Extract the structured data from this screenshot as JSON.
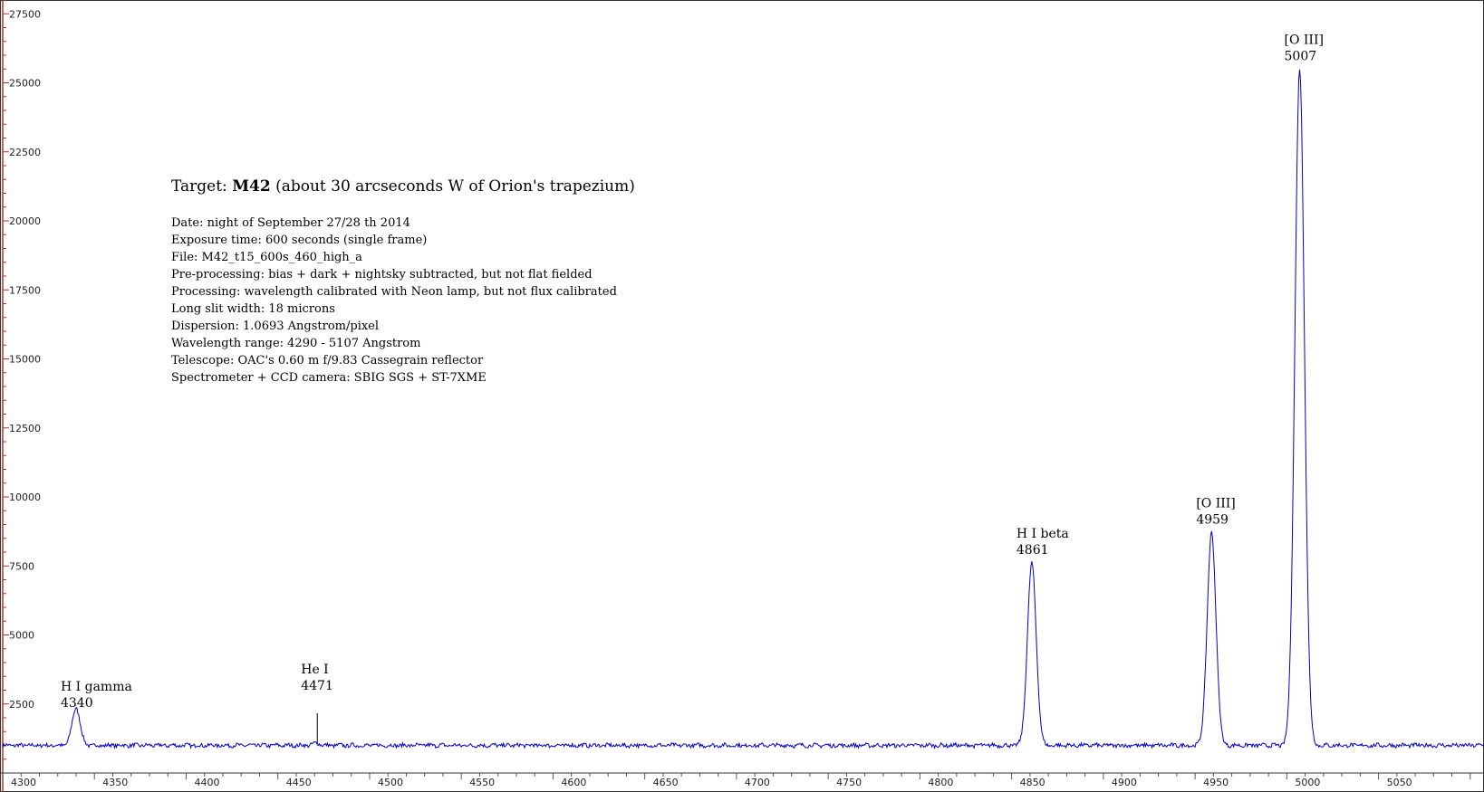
{
  "chart_data": {
    "type": "line",
    "xlim": [
      4300,
      5107
    ],
    "ylim": [
      0,
      28000
    ],
    "x_ticks": [
      4300,
      4350,
      4400,
      4450,
      4500,
      4550,
      4600,
      4650,
      4700,
      4750,
      4800,
      4850,
      4900,
      4950,
      5000,
      5050
    ],
    "y_ticks": [
      2500,
      5000,
      7500,
      10000,
      12500,
      15000,
      17500,
      20000,
      22500,
      25000,
      27500
    ],
    "line_color": "#0000cc",
    "axis_color": "#b03030",
    "baseline": 1000,
    "peaks": [
      {
        "label": "H I gamma",
        "wavelength": "4340",
        "x": 4340,
        "y": 2350,
        "width": 2.2
      },
      {
        "label": "He I",
        "wavelength": "4471",
        "x": 4471,
        "y": 1080,
        "width": 2.0
      },
      {
        "label": "H I beta",
        "wavelength": "4861",
        "x": 4861,
        "y": 7600,
        "width": 2.4
      },
      {
        "label": "[O III]",
        "wavelength": "4959",
        "x": 4959,
        "y": 8700,
        "width": 2.4
      },
      {
        "label": "[O III]",
        "wavelength": "5007",
        "x": 5007,
        "y": 25500,
        "width": 2.6
      }
    ],
    "annotation": {
      "title_prefix": "Target: ",
      "title_bold": "M42",
      "title_suffix": " (about 30 arcseconds W of Orion's trapezium)",
      "lines": [
        "Date: night of September 27/28 th 2014",
        "Exposure time: 600 seconds (single frame)",
        "File: M42_t15_600s_460_high_a",
        "Pre-processing: bias + dark + nightsky subtracted, but not flat fielded",
        "Processing: wavelength calibrated with Neon lamp, but not flux calibrated",
        "Long slit width: 18 microns",
        "Dispersion: 1.0693 Angstrom/pixel",
        "Wavelength range: 4290 - 5107 Angstrom",
        "Telescope: OAC's 0.60 m f/9.83 Cassegrain reflector",
        "Spectrometer + CCD camera: SBIG SGS + ST-7XME"
      ]
    }
  }
}
